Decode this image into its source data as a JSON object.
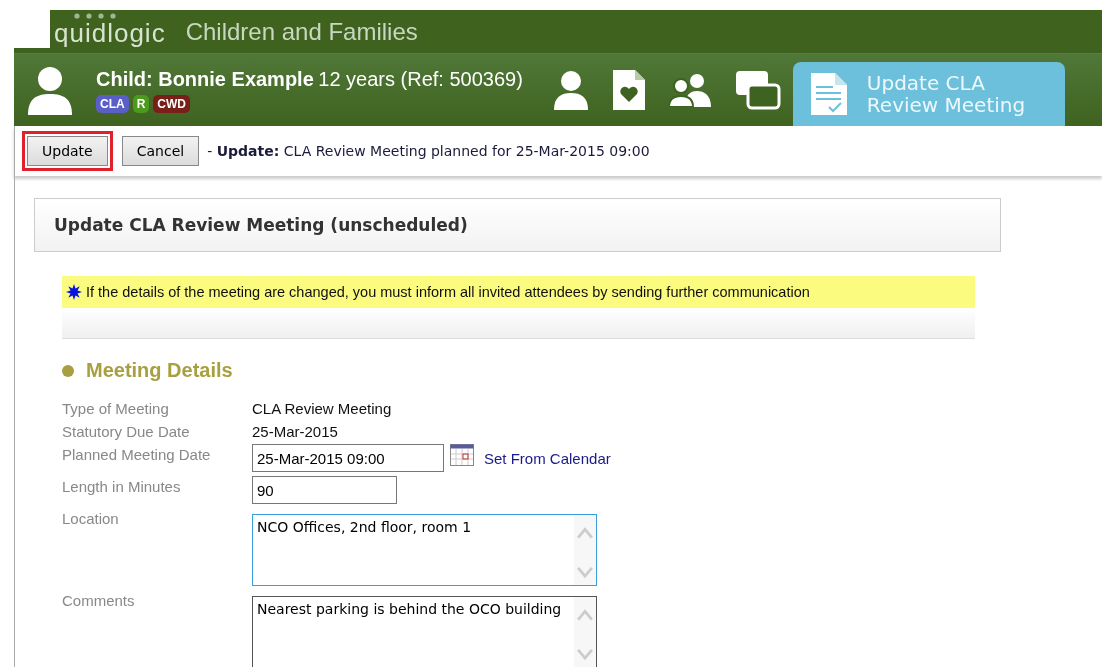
{
  "app": {
    "logo": "quidlogic",
    "title": "Children and Families"
  },
  "child": {
    "name": "Child: Bonnie Example",
    "details": "12 years (Ref: 500369)",
    "badges": [
      {
        "label": "CLA",
        "color": "#5a5fc8"
      },
      {
        "label": "R",
        "color": "#4c9a1c"
      },
      {
        "label": "CWD",
        "color": "#7a1f17"
      }
    ]
  },
  "nav": [
    {
      "kind": "person",
      "selected": false
    },
    {
      "kind": "document-heart",
      "selected": false
    },
    {
      "kind": "people",
      "selected": false
    },
    {
      "kind": "windows",
      "selected": false
    },
    {
      "kind": "document-check",
      "label": "Update CLA Review Meeting",
      "selected": true
    }
  ],
  "toolbar": {
    "buttons": [
      {
        "label": "Update",
        "highlighted": true
      },
      {
        "label": "Cancel",
        "highlighted": false
      }
    ],
    "status_prefix": "- ",
    "status_bold": "Update:",
    "status_text": "CLA Review Meeting planned for 25-Mar-2015 09:00"
  },
  "panel_title": "Update CLA Review Meeting (unscheduled)",
  "notice": "If the details of the meeting are changed, you must inform all invited attendees by sending further communication",
  "section": "Meeting Details",
  "fields": [
    {
      "kind": "text",
      "label": "Type of Meeting",
      "value": "CLA Review Meeting"
    },
    {
      "kind": "text",
      "label": "Statutory Due Date",
      "value": "25-Mar-2015"
    },
    {
      "kind": "date",
      "label": "Planned Meeting Date",
      "value": "25-Mar-2015 09:00",
      "link": "Set From Calendar"
    },
    {
      "kind": "input",
      "label": "Length in Minutes",
      "value": "90"
    },
    {
      "kind": "textarea",
      "label": "Location",
      "value": "NCO Offices, 2nd floor, room 1",
      "focused": true
    },
    {
      "kind": "textarea",
      "label": "Comments",
      "value": "Nearest parking is behind the OCO building",
      "focused": false
    }
  ]
}
